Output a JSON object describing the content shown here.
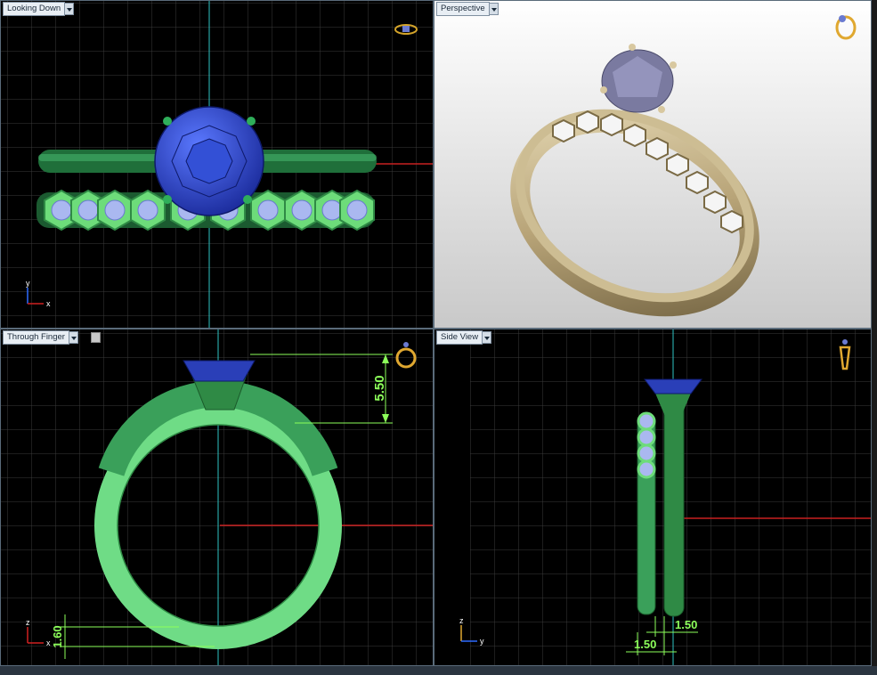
{
  "viewports": {
    "top_left": {
      "label": "Looking Down"
    },
    "top_right": {
      "label": "Perspective"
    },
    "bottom_left": {
      "label": "Through Finger"
    },
    "bottom_right": {
      "label": "Side View"
    }
  },
  "dimensions": {
    "top_height": "5.50",
    "band_thickness": "1.60",
    "band_width_a": "1.50",
    "band_width_b": "1.50"
  },
  "axes": {
    "top_left": {
      "vertical": "y",
      "horizontal": "x"
    },
    "bottom_left": {
      "vertical": "z",
      "horizontal": "x"
    },
    "bottom_right": {
      "vertical": "z",
      "horizontal": "y"
    }
  },
  "colors": {
    "grid_bg": "#000000",
    "grid_line": "#3a3a3a",
    "cad_green": "#2fae5a",
    "stone_blue": "#2a3fb8",
    "dimension": "#8cff5a",
    "gold": "#c9b68e"
  }
}
